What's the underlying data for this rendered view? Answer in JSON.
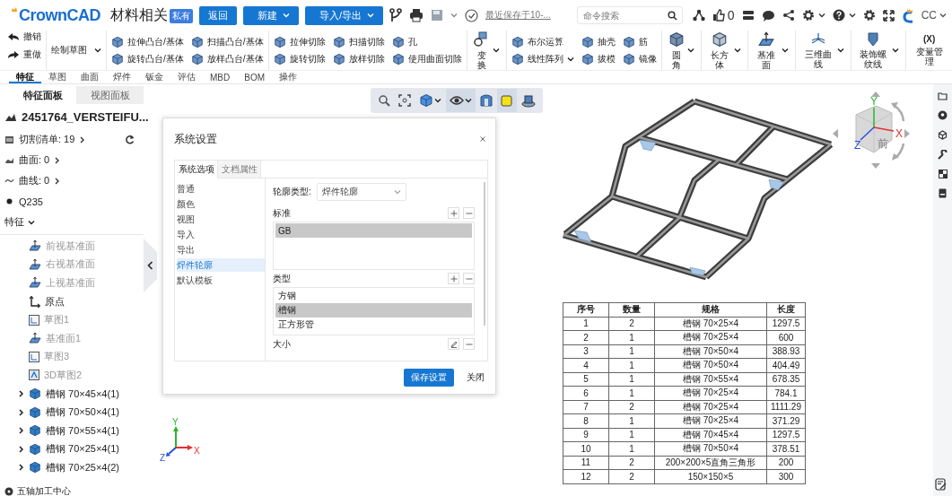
{
  "header": {
    "logo": "CrownCAD",
    "title": "材料相关",
    "badge": "私有",
    "buttons": [
      {
        "label": "返回",
        "dropdown": false
      },
      {
        "label": "新建",
        "dropdown": true
      },
      {
        "label": "导入/导出",
        "dropdown": true
      }
    ],
    "save_status": "最近保存于10-...",
    "search": {
      "placeholder": "命令搜索"
    },
    "likes": "0",
    "user": "CC"
  },
  "ribbon": {
    "undo": "撤销",
    "redo": "重做",
    "sketch": "绘制草图",
    "groups": [
      {
        "kind": "small",
        "items": [
          {
            "label": "拉伸凸台/基体",
            "dropdown": false
          },
          {
            "label": "扫描凸台/基体",
            "dropdown": false
          },
          {
            "label": "旋转凸台/基体",
            "dropdown": false
          },
          {
            "label": "放样凸台/基体",
            "dropdown": false
          }
        ]
      },
      {
        "kind": "small",
        "items": [
          {
            "label": "拉伸切除",
            "dropdown": false
          },
          {
            "label": "扫描切除",
            "dropdown": false
          },
          {
            "label": "孔",
            "dropdown": false
          },
          {
            "label": "旋转切除",
            "dropdown": false
          },
          {
            "label": "放样切除",
            "dropdown": false
          },
          {
            "label": "使用曲面切除",
            "dropdown": false
          }
        ]
      },
      {
        "kind": "big",
        "label": "变换",
        "dropdown": true
      },
      {
        "kind": "small",
        "items": [
          {
            "label": "布尔运算",
            "dropdown": false
          },
          {
            "label": "抽壳",
            "dropdown": false
          },
          {
            "label": "筋",
            "dropdown": false
          },
          {
            "label": "线性阵列",
            "dropdown": true
          },
          {
            "label": "拔模",
            "dropdown": false
          },
          {
            "label": "镜像",
            "dropdown": false
          }
        ]
      },
      {
        "kind": "big",
        "label": "圆角",
        "dropdown": true
      },
      {
        "kind": "big",
        "label": "长方体",
        "dropdown": true
      },
      {
        "kind": "big",
        "label": "基准面",
        "dropdown": true
      },
      {
        "kind": "big",
        "label": "三维曲线",
        "dropdown": true
      },
      {
        "kind": "big",
        "label": "装饰螺纹线",
        "dropdown": true
      },
      {
        "kind": "big",
        "icon_text": "(X)",
        "label": "变量管理",
        "dropdown": false
      }
    ]
  },
  "tabs": [
    {
      "label": "特征",
      "selected": true
    },
    {
      "label": "草图",
      "selected": false
    },
    {
      "label": "曲面",
      "selected": false
    },
    {
      "label": "焊件",
      "selected": false
    },
    {
      "label": "钣金",
      "selected": false
    },
    {
      "label": "评估",
      "selected": false
    },
    {
      "label": "MBD",
      "selected": false
    },
    {
      "label": "BOM",
      "selected": false
    },
    {
      "label": "操作",
      "selected": false
    }
  ],
  "sidebar": {
    "panel_tabs": [
      {
        "label": "特征面板",
        "selected": true
      },
      {
        "label": "视图面板",
        "selected": false
      }
    ],
    "part": "2451764_VERSTEIFU...",
    "cut_list": "切割清单: 19",
    "surfaces": "曲面: 0",
    "curves": "曲线: 0",
    "material": "Q235",
    "features_heading": "特征",
    "features_expanded": true,
    "features": [
      {
        "kind": "plane",
        "label": "前视基准面",
        "dimmed": true
      },
      {
        "kind": "plane",
        "label": "右视基准面",
        "dimmed": true
      },
      {
        "kind": "plane",
        "label": "上视基准面",
        "dimmed": true
      },
      {
        "kind": "origin",
        "label": "原点",
        "dimmed": false
      },
      {
        "kind": "sketch",
        "label": "草图1",
        "dimmed": true
      },
      {
        "kind": "plane",
        "label": "基准面1",
        "dimmed": true
      },
      {
        "kind": "sketch",
        "label": "草图3",
        "dimmed": true
      },
      {
        "kind": "sketch3d",
        "label": "3D草图2",
        "dimmed": true
      },
      {
        "kind": "body",
        "label": "槽钢 70×45×4(1)",
        "dimmed": false,
        "expanded": false
      },
      {
        "kind": "body",
        "label": "槽钢 70×50×4(1)",
        "dimmed": false,
        "expanded": false
      },
      {
        "kind": "body",
        "label": "槽钢 70×55×4(1)",
        "dimmed": false,
        "expanded": false
      },
      {
        "kind": "body",
        "label": "槽钢 70×25×4(1)",
        "dimmed": false,
        "expanded": false
      },
      {
        "kind": "body",
        "label": "槽钢 70×25×4(2)",
        "dimmed": false,
        "expanded": false
      }
    ],
    "footer": "五轴加工中心"
  },
  "view_tools": [
    {
      "kind": "zoom",
      "active": false,
      "dropdown": false
    },
    {
      "kind": "fit",
      "active": false,
      "dropdown": false
    },
    {
      "kind": "display",
      "active": false,
      "dropdown": true
    },
    {
      "kind": "eye",
      "active": true,
      "dropdown": true
    },
    {
      "kind": "section",
      "active": false,
      "dropdown": false
    },
    {
      "kind": "shaded",
      "active": true,
      "dropdown": false
    },
    {
      "kind": "render",
      "active": false,
      "dropdown": false
    }
  ],
  "view_cube": {
    "face": "前",
    "axes": [
      "X",
      "Y",
      "Z"
    ]
  },
  "triad": {
    "axes": [
      "X",
      "Y",
      "Z"
    ]
  },
  "dialog": {
    "title": "系统设置",
    "tabs": [
      {
        "label": "系统选项",
        "selected": true
      },
      {
        "label": "文档属性",
        "selected": false
      }
    ],
    "nav": [
      {
        "label": "普通",
        "selected": false
      },
      {
        "label": "颜色",
        "selected": false
      },
      {
        "label": "视图",
        "selected": false
      },
      {
        "label": "导入",
        "selected": false
      },
      {
        "label": "导出",
        "selected": false
      },
      {
        "label": "焊件轮廓",
        "selected": true
      },
      {
        "label": "默认模板",
        "selected": false
      }
    ],
    "profile_type_label": "轮廓类型:",
    "profile_type": "焊件轮廓",
    "sections": [
      {
        "label": "标准",
        "items": [
          {
            "label": "GB",
            "selected": true
          }
        ]
      },
      {
        "label": "类型",
        "items": [
          {
            "label": "方钢",
            "selected": false
          },
          {
            "label": "槽钢",
            "selected": true
          },
          {
            "label": "正方形管",
            "selected": false
          }
        ]
      },
      {
        "label": "大小"
      }
    ],
    "buttons": [
      {
        "label": "保存设置",
        "primary": true
      },
      {
        "label": "关闭",
        "primary": false
      }
    ]
  },
  "table": {
    "columns": [
      "序号",
      "数量",
      "规格",
      "长度"
    ],
    "rows": [
      [
        "1",
        "2",
        "槽钢 70×25×4",
        "1297.5"
      ],
      [
        "2",
        "1",
        "槽钢 70×25×4",
        "600"
      ],
      [
        "3",
        "1",
        "槽钢 70×50×4",
        "388.93"
      ],
      [
        "4",
        "1",
        "槽钢 70×50×4",
        "404.49"
      ],
      [
        "5",
        "1",
        "槽钢 70×55×4",
        "678.35"
      ],
      [
        "6",
        "1",
        "槽钢 70×25×4",
        "784.1"
      ],
      [
        "7",
        "2",
        "槽钢 70×25×4",
        "1111.29"
      ],
      [
        "8",
        "1",
        "槽钢 70×25×4",
        "371.29"
      ],
      [
        "9",
        "1",
        "槽钢 70×45×4",
        "1297.5"
      ],
      [
        "10",
        "1",
        "槽钢 70×50×4",
        "378.51"
      ],
      [
        "11",
        "2",
        "200×200×5直角三角形",
        "200"
      ],
      [
        "12",
        "2",
        "150×150×5",
        "300"
      ]
    ]
  }
}
